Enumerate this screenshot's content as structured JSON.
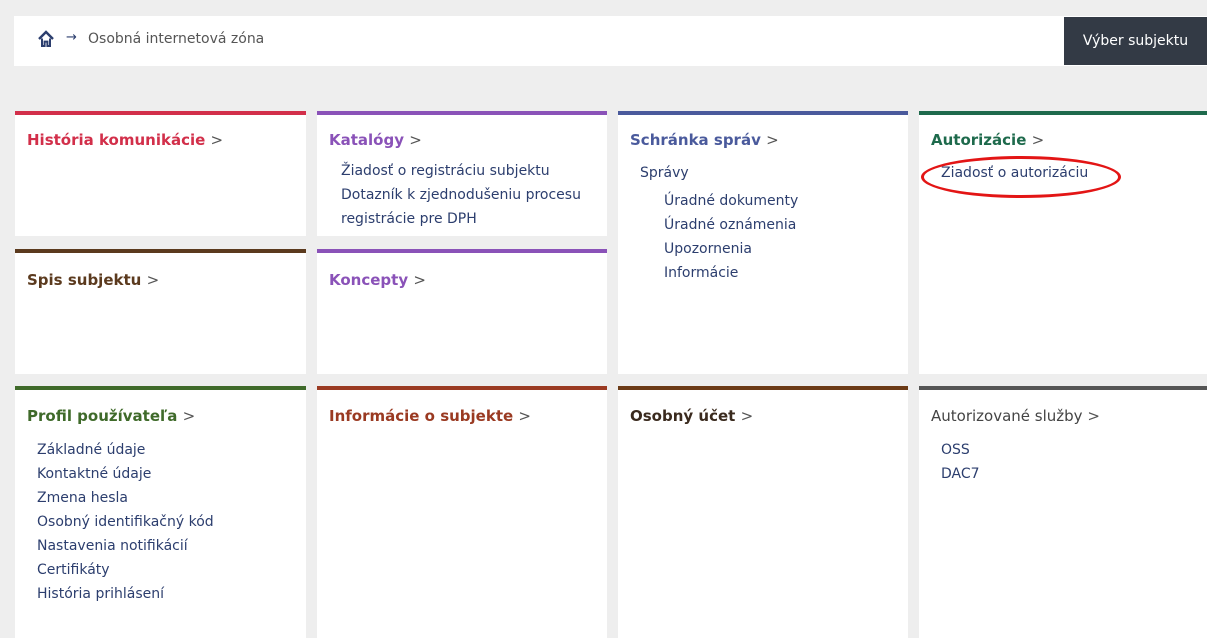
{
  "breadcrumb": {
    "arrow": "→",
    "current": "Osobná internetová zóna"
  },
  "header": {
    "subject_button": "Výber subjektu"
  },
  "gt": ">",
  "tiles": {
    "historia": {
      "title": "História komunikácie",
      "color": "#d22f4a"
    },
    "katalogy": {
      "title": "Katalógy",
      "color": "#8a52b8",
      "items": [
        "Žiadosť o registráciu subjektu",
        "Dotazník k zjednodušeniu procesu",
        "registrácie pre DPH"
      ]
    },
    "schranka": {
      "title": "Schránka správ",
      "color": "#4a5a9c",
      "items": [
        "Správy"
      ],
      "sub_items": [
        "Úradné dokumenty",
        "Úradné oznámenia",
        "Upozornenia",
        "Informácie"
      ]
    },
    "autorizacie": {
      "title": "Autorizácie",
      "color": "#1e6a4c",
      "items": [
        "Žiadosť o autorizáciu"
      ]
    },
    "spis": {
      "title": "Spis subjektu",
      "color": "#5b3a1e"
    },
    "koncepty": {
      "title": "Koncepty",
      "color": "#8a52b8"
    },
    "profil": {
      "title": "Profil používateľa",
      "color": "#3f6a2a",
      "items": [
        "Základné údaje",
        "Kontaktné údaje",
        "Zmena hesla",
        "Osobný identifikačný kód",
        "Nastavenia notifikácií",
        "Certifikáty",
        "História prihlásení"
      ]
    },
    "informacie": {
      "title": "Informácie o subjekte",
      "color": "#9a3a22"
    },
    "ucet": {
      "title": "Osobný účet",
      "color": "#6b3a16"
    },
    "sluzby": {
      "title": "Autorizované služby",
      "color": "#555555",
      "items": [
        "OSS",
        "DAC7"
      ]
    }
  },
  "annotation": {
    "color": "#e31515"
  }
}
